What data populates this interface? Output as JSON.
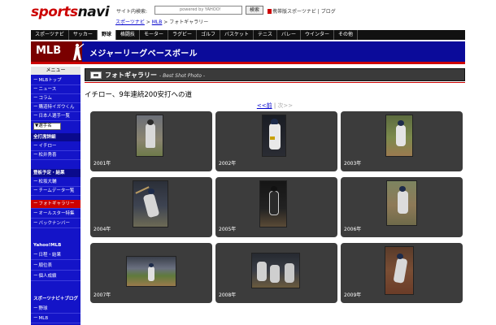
{
  "header": {
    "logo_text_a": "sports",
    "logo_text_b": "navi",
    "search_label": "サイト内検索:",
    "search_placeholder": "powered by YAHOO!",
    "search_button": "検索",
    "mobile_link": "携帯版スポーツナビ",
    "blog_link": "ブログ",
    "breadcrumb": {
      "items": [
        "スポーツナビ",
        "MLB",
        "フォトギャラリー"
      ],
      "separator": " > "
    }
  },
  "topnav": {
    "items": [
      "スポーツナビ",
      "サッカー",
      "野球",
      "格闘技",
      "モーター",
      "ラグビー",
      "ゴルフ",
      "バスケット",
      "テニス",
      "バレー",
      "ウインター",
      "その他"
    ],
    "active": "野球"
  },
  "banner": {
    "logo": "MLB",
    "title": "メジャーリーグベースボール"
  },
  "sidebar": {
    "menu_title": "メニュー",
    "items_top": [
      "MLBトップ",
      "ニュース",
      "コラム",
      "購道特イガウくん",
      "日本人選手一覧"
    ],
    "select_label": "▼選手名",
    "section_bakko": "全打席詳細",
    "items_bakko": [
      "イチロー",
      "松井秀喜"
    ],
    "section_schedule": "登板予定・結果",
    "items_schedule": [
      "松坂大輔",
      "チームデータ一覧",
      "フォトギャラリー",
      "オールスター特集",
      "バックナンバー"
    ],
    "active_item": "フォトギャラリー",
    "yahoo_title": "Yahoo!MLB",
    "items_yahoo": [
      "日程・結果",
      "順位表",
      "個人成績"
    ],
    "blog_title": "スポーツナビ＋ブログ",
    "items_blog": [
      "野球",
      "MLB"
    ]
  },
  "main": {
    "section_title": "フォトギャラリー",
    "section_subtitle": "- Best Shot Photo -",
    "gallery_title": "イチロー、9年連続200安打への道",
    "pager": {
      "prev": "<<前",
      "separator": "|",
      "next": "次>>"
    },
    "photos": [
      {
        "year": "2001年"
      },
      {
        "year": "2002年"
      },
      {
        "year": "2003年"
      },
      {
        "year": "2004年"
      },
      {
        "year": "2005年"
      },
      {
        "year": "2006年"
      },
      {
        "year": "2007年"
      },
      {
        "year": "2008年"
      },
      {
        "year": "2009年"
      }
    ]
  },
  "colors": {
    "brand_red": "#cc0000",
    "sidebar_blue": "#1414c8",
    "banner_blue": "#0b0b9a",
    "tile_gray": "#3c3c3c"
  }
}
